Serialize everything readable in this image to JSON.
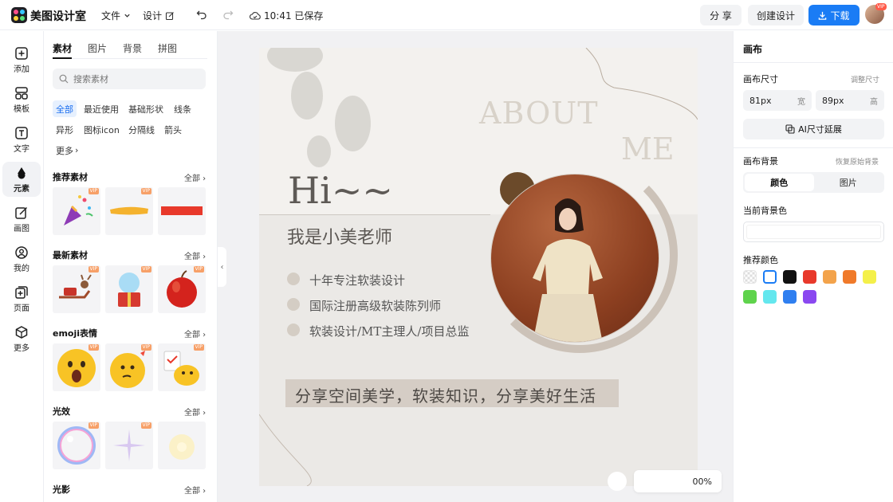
{
  "topbar": {
    "brand": "美图设计室",
    "file_menu": "文件",
    "design_menu": "设计",
    "save_status": "10:41 已保存",
    "share_label": "分 享",
    "create_label": "创建设计",
    "download_label": "下载",
    "avatar_badge": "VIP"
  },
  "rail": {
    "items": [
      {
        "label": "添加",
        "icon": "plus-square-icon"
      },
      {
        "label": "模板",
        "icon": "template-grid-icon"
      },
      {
        "label": "文字",
        "icon": "text-box-icon"
      },
      {
        "label": "元素",
        "icon": "shapes-icon"
      },
      {
        "label": "画图",
        "icon": "pencil-edit-icon"
      },
      {
        "label": "我的",
        "icon": "user-icon"
      },
      {
        "label": "页面",
        "icon": "add-page-icon"
      },
      {
        "label": "更多",
        "icon": "cube-icon"
      }
    ],
    "active_index": 3
  },
  "panel": {
    "tabs": [
      "素材",
      "图片",
      "背景",
      "拼图"
    ],
    "active_tab": 0,
    "search_placeholder": "搜索素材",
    "chips": [
      "全部",
      "最近使用",
      "基础形状",
      "线条",
      "异形",
      "图标icon",
      "分隔线",
      "箭头",
      "更多"
    ],
    "active_chip": 0,
    "all_label": "全部",
    "vip_label": "VIP",
    "sections": [
      {
        "title": "推荐素材"
      },
      {
        "title": "最新素材"
      },
      {
        "title": "emoji表情"
      },
      {
        "title": "光效"
      },
      {
        "title": "光影"
      }
    ]
  },
  "poster": {
    "about": "ABOUT",
    "me": "ME",
    "hi": "Hi~~",
    "subtitle": "我是小美老师",
    "bullets": [
      "十年专注软装设计",
      "国际注册高级软装陈列师",
      "软装设计/MT主理人/项目总监"
    ],
    "tagline": "分享空间美学，软装知识，分享美好生活"
  },
  "zoom": {
    "value": "00%"
  },
  "right_panel": {
    "title": "画布",
    "size_label": "画布尺寸",
    "size_hint": "调整尺寸",
    "width_value": "81px",
    "width_unit": "宽",
    "height_value": "89px",
    "height_unit": "高",
    "ai_button": "AI尺寸延展",
    "bg_label": "画布背景",
    "bg_hint": "恢复原始背景",
    "seg_color": "颜色",
    "seg_image": "图片",
    "current_bg_label": "当前背景色",
    "current_bg_color": "#ffffff",
    "recommend_label": "推荐颜色",
    "swatches": [
      "transparent",
      "#ffffff",
      "#111111",
      "#e8392b",
      "#f3a34b",
      "#f07a2a",
      "#f4f04a",
      "#5fd34c",
      "#64e7ee",
      "#2f7ff0",
      "#8a48f0"
    ]
  }
}
